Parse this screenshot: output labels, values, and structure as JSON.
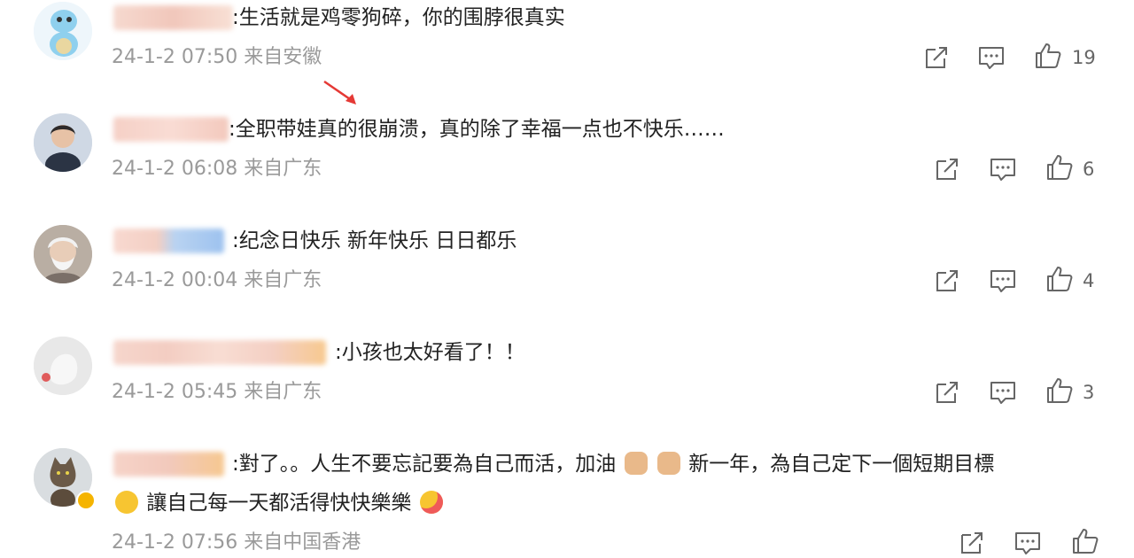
{
  "comments": [
    {
      "text": ":生活就是鸡零狗碎，你的围脖很真实",
      "meta": "24-1-2 07:50 来自安徽",
      "likes": "19",
      "avatar_icon": "squirtle-avatar-icon"
    },
    {
      "text": ":全职带娃真的很崩溃，真的除了幸福一点也不快乐……",
      "meta": "24-1-2 06:08 来自广东",
      "likes": "6",
      "avatar_icon": "child-avatar-icon"
    },
    {
      "text": ":纪念日快乐 新年快乐 日日都乐",
      "meta": "24-1-2 00:04 来自广东",
      "likes": "4",
      "avatar_icon": "elder-avatar-icon"
    },
    {
      "text": ":小孩也太好看了！！",
      "meta": "24-1-2 05:45 来自广东",
      "likes": "3",
      "avatar_icon": "hand-avatar-icon"
    },
    {
      "text_line1_a": ":對了。。人生不要忘記要為自己而活，加油",
      "text_line1_b": "新一年，為自己定下一個短期目標",
      "text_line2": "讓自己每一天都活得快快樂樂",
      "meta": "24-1-2 07:56 来自中国香港",
      "avatar_icon": "cat-avatar-icon"
    }
  ],
  "colors": {
    "text": "#222222",
    "meta": "#9a9a9a",
    "icon": "#666666",
    "arrow": "#e53935"
  },
  "icons": [
    "share-icon",
    "comment-icon",
    "like-icon",
    "red-arrow-icon",
    "muscle-emoji-icon",
    "smile-emoji-icon",
    "tongue-emoji-icon"
  ]
}
